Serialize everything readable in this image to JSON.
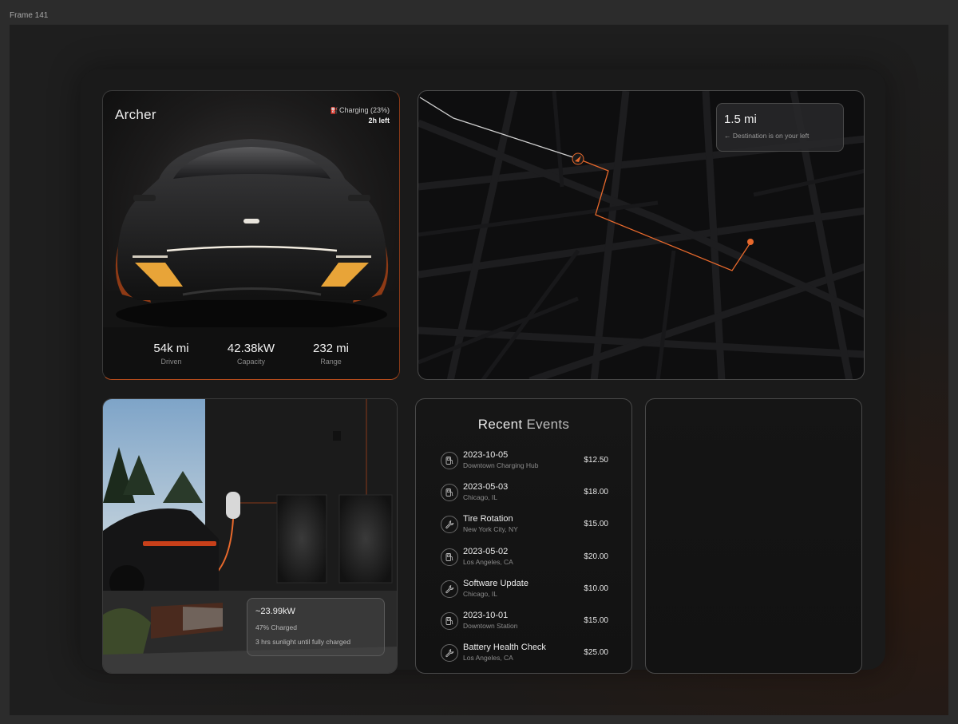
{
  "frame": {
    "label": "Frame 141"
  },
  "car": {
    "name": "Archer",
    "charging_status": "Charging (23%)",
    "time_left": "2h left",
    "stats": [
      {
        "value": "54k mi",
        "label": "Driven"
      },
      {
        "value": "42.38kW",
        "label": "Capacity"
      },
      {
        "value": "232 mi",
        "label": "Range"
      }
    ]
  },
  "map": {
    "distance": "1.5 mi",
    "direction_text": "← Destination is on your left"
  },
  "solar": {
    "power": "~23.99kW",
    "charged": "47% Charged",
    "sunlight_note": "3 hrs sunlight until fully charged"
  },
  "events": {
    "title_part1": "Recent",
    "title_part2": "Events",
    "items": [
      {
        "name": "2023-10-05",
        "location": "Downtown Charging Hub",
        "amount": "$12.50",
        "icon": "charging-station-icon"
      },
      {
        "name": "2023-05-03",
        "location": "Chicago, IL",
        "amount": "$18.00",
        "icon": "charging-station-icon"
      },
      {
        "name": "Tire Rotation",
        "location": "New York City, NY",
        "amount": "$15.00",
        "icon": "wrench-icon"
      },
      {
        "name": "2023-05-02",
        "location": "Los Angeles, CA",
        "amount": "$20.00",
        "icon": "charging-station-icon"
      },
      {
        "name": "Software Update",
        "location": "Chicago, IL",
        "amount": "$10.00",
        "icon": "wrench-icon"
      },
      {
        "name": "2023-10-01",
        "location": "Downtown Station",
        "amount": "$15.00",
        "icon": "charging-station-icon"
      },
      {
        "name": "Battery Health Check",
        "location": "Los Angeles, CA",
        "amount": "$25.00",
        "icon": "wrench-icon"
      }
    ]
  },
  "colors": {
    "accent": "#e8692c",
    "background": "#1a1a1a"
  }
}
